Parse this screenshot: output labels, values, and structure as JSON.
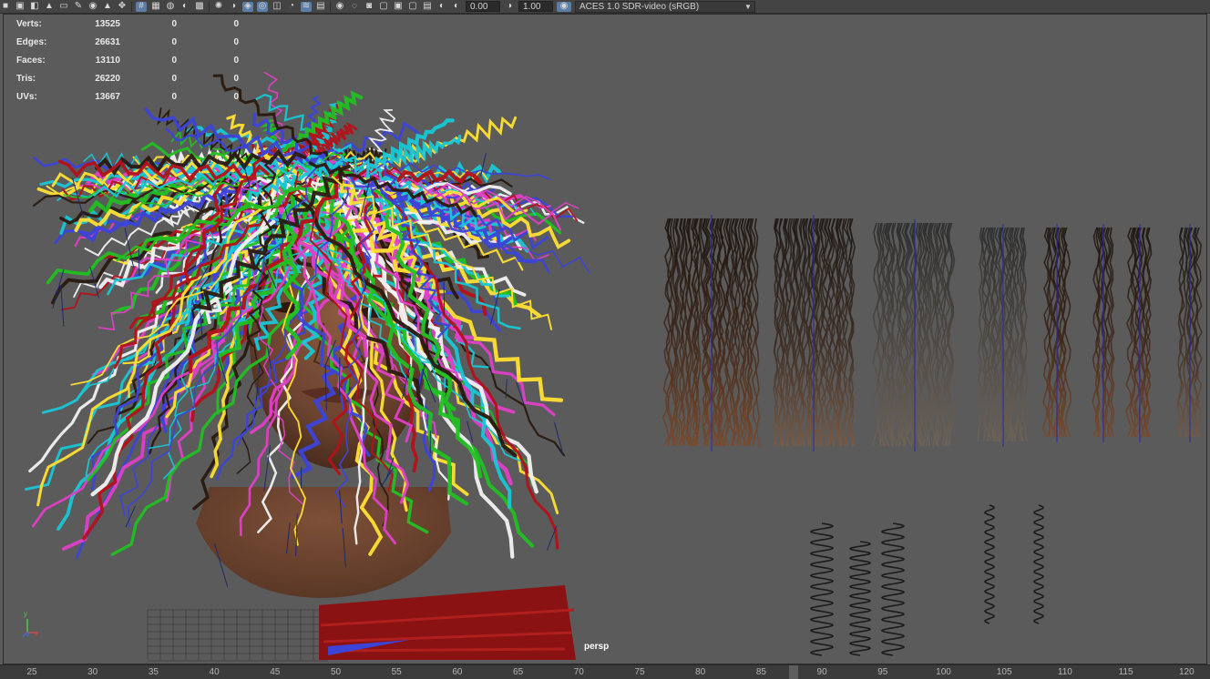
{
  "toolbar": {
    "icons": [
      "camera-icon",
      "camera-lock-icon",
      "camera-attributes-icon",
      "bookmark-icon",
      "image-plane-icon",
      "grease-pencil-icon",
      "isolate-icon",
      "bookmark-2-icon",
      "two-d-pan-icon",
      "grid-icon",
      "wireframe-icon",
      "smooth-shade-icon",
      "default-material-icon",
      "textured-icon",
      "use-lights-icon",
      "shadows-icon",
      "xray-icon",
      "xray-joints-icon",
      "backface-icon",
      "ao-icon",
      "motion-blur-icon",
      "aa-icon",
      "dof-icon",
      "isolate-select-icon",
      "xray-active-icon",
      "resolution-gate-icon",
      "safe-title-icon",
      "film-gate-icon",
      "field-chart-icon",
      "exposure-icon"
    ],
    "exposure_value": "0.00",
    "gamma_value": "1.00",
    "colorspace": "ACES 1.0 SDR-video (sRGB)"
  },
  "hud": {
    "rows": [
      {
        "label": "Verts:",
        "value": "13525",
        "c1": "0",
        "c2": "0"
      },
      {
        "label": "Edges:",
        "value": "26631",
        "c1": "0",
        "c2": "0"
      },
      {
        "label": "Faces:",
        "value": "13110",
        "c1": "0",
        "c2": "0"
      },
      {
        "label": "Tris:",
        "value": "26220",
        "c1": "0",
        "c2": "0"
      },
      {
        "label": "UVs:",
        "value": "13667",
        "c1": "0",
        "c2": "0"
      }
    ]
  },
  "viewport": {
    "camera": "persp",
    "axis_labels": [
      "y",
      "z",
      "x"
    ],
    "strand_colors": [
      "#ffe033",
      "#19c7d6",
      "#22c022",
      "#e040c8",
      "#3c44d8",
      "#b3121a",
      "#f2f2f2",
      "#2a1a10"
    ]
  },
  "timeline": {
    "ticks": [
      "25",
      "30",
      "35",
      "40",
      "45",
      "50",
      "55",
      "60",
      "65",
      "70",
      "75",
      "80",
      "85",
      "90",
      "95",
      "100",
      "105",
      "110",
      "115",
      "120"
    ]
  }
}
